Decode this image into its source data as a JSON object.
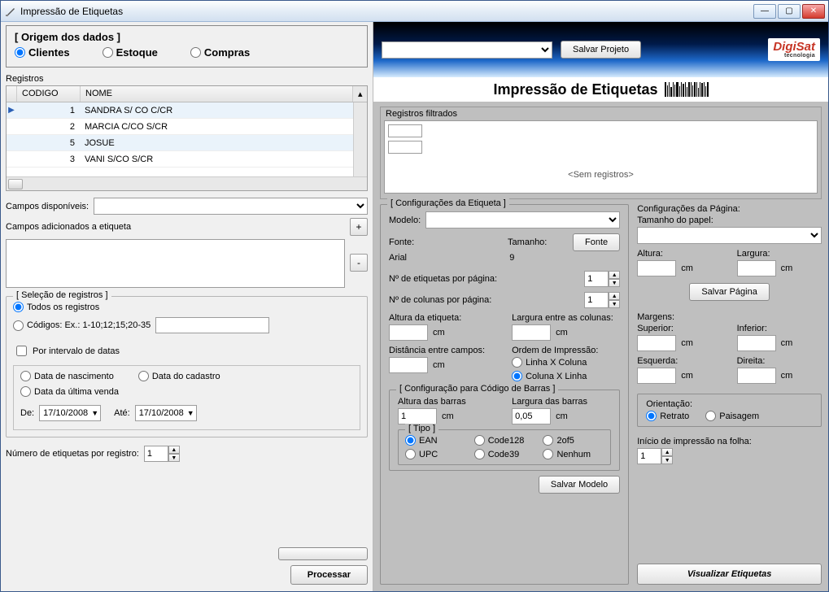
{
  "window": {
    "title": "Impressão de Etiquetas"
  },
  "origem": {
    "title": "[ Origem dos dados ]",
    "clientes": "Clientes",
    "estoque": "Estoque",
    "compras": "Compras"
  },
  "registros": {
    "label": "Registros",
    "cols": {
      "codigo": "CODIGO",
      "nome": "NOME"
    },
    "rows": [
      {
        "codigo": "1",
        "nome": "SANDRA S/ CO C/CR"
      },
      {
        "codigo": "2",
        "nome": "MARCIA C/CO S/CR"
      },
      {
        "codigo": "5",
        "nome": "JOSUE"
      },
      {
        "codigo": "3",
        "nome": "VANI S/CO S/CR"
      }
    ]
  },
  "campos": {
    "disponiveis": "Campos disponíveis:",
    "adicionados": "Campos adicionados a etiqueta",
    "add": "+",
    "remove": "-"
  },
  "selecao": {
    "title": "[ Seleção de registros ]",
    "todos": "Todos os registros",
    "codigos": "Códigos: Ex.: 1-10;12;15;20-35",
    "por_intervalo": "Por intervalo de datas",
    "nascimento": "Data de nascimento",
    "cadastro": "Data do cadastro",
    "ultima_venda": "Data da última venda",
    "de": "De:",
    "ate": "Até:",
    "de_val": "17/10/2008",
    "ate_val": "17/10/2008"
  },
  "numero_etiquetas": {
    "label": "Número de etiquetas por registro:",
    "value": "1"
  },
  "processar": "Processar",
  "top": {
    "salvar_projeto": "Salvar Projeto"
  },
  "logo": {
    "name": "DigiSat",
    "sub": "tecnologia"
  },
  "heading": "Impressão de Etiquetas",
  "rf": {
    "title": "Registros filtrados",
    "empty": "<Sem registros>"
  },
  "cfg_etiqueta": {
    "title": "[ Configurações da Etiqueta ]",
    "modelo": "Modelo:",
    "fonte_lbl": "Fonte:",
    "fonte_val": "Arial",
    "tamanho_lbl": "Tamanho:",
    "tamanho_val": "9",
    "fonte_btn": "Fonte",
    "n_etq": "Nº de etiquetas por página:",
    "n_etq_val": "1",
    "n_col": "Nº de colunas por página:",
    "n_col_val": "1",
    "alt_etq": "Altura da etiqueta:",
    "larg_col": "Largura entre as colunas:",
    "dist_campos": "Distância entre campos:",
    "ordem": "Ordem de Impressão:",
    "linha_coluna": "Linha X Coluna",
    "coluna_linha": "Coluna X Linha",
    "cm": "cm"
  },
  "barras": {
    "title": "[ Configuração para Código de Barras ]",
    "alt": "Altura das barras",
    "alt_val": "1",
    "larg": "Largura das barras",
    "larg_val": "0,05",
    "cm": "cm",
    "tipo_title": "[ Tipo ]",
    "ean": "EAN",
    "upc": "UPC",
    "code128": "Code128",
    "code39": "Code39",
    "_2of5": "2of5",
    "nenhum": "Nenhum",
    "salvar_modelo": "Salvar Modelo"
  },
  "cfg_pagina": {
    "title": "Configurações da Página:",
    "tam_papel": "Tamanho do papel:",
    "altura": "Altura:",
    "largura": "Largura:",
    "salvar_pagina": "Salvar Página",
    "margens": "Margens:",
    "sup": "Superior:",
    "inf": "Inferior:",
    "esq": "Esquerda:",
    "dir": "Direita:",
    "cm": "cm",
    "orientacao": "Orientação:",
    "retrato": "Retrato",
    "paisagem": "Paisagem",
    "inicio": "Início de impressão na folha:",
    "inicio_val": "1",
    "visualizar": "Visualizar Etiquetas"
  }
}
